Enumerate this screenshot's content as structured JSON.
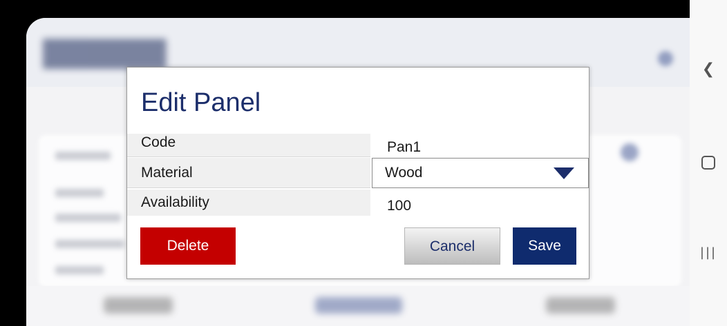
{
  "dialog": {
    "title": "Edit Panel",
    "fields": {
      "code": {
        "label": "Code",
        "value": "Pan1"
      },
      "material": {
        "label": "Material",
        "value": "Wood"
      },
      "availability": {
        "label": "Availability",
        "value": "100"
      }
    },
    "buttons": {
      "delete": "Delete",
      "cancel": "Cancel",
      "save": "Save"
    }
  },
  "colors": {
    "title": "#1c2e6b",
    "delete": "#c40000",
    "save": "#0f2b6e"
  },
  "icons": {
    "material_dropdown": "chevron-down-icon",
    "sys_back": "back-icon",
    "sys_home": "home-icon",
    "sys_recent": "recent-apps-icon"
  }
}
